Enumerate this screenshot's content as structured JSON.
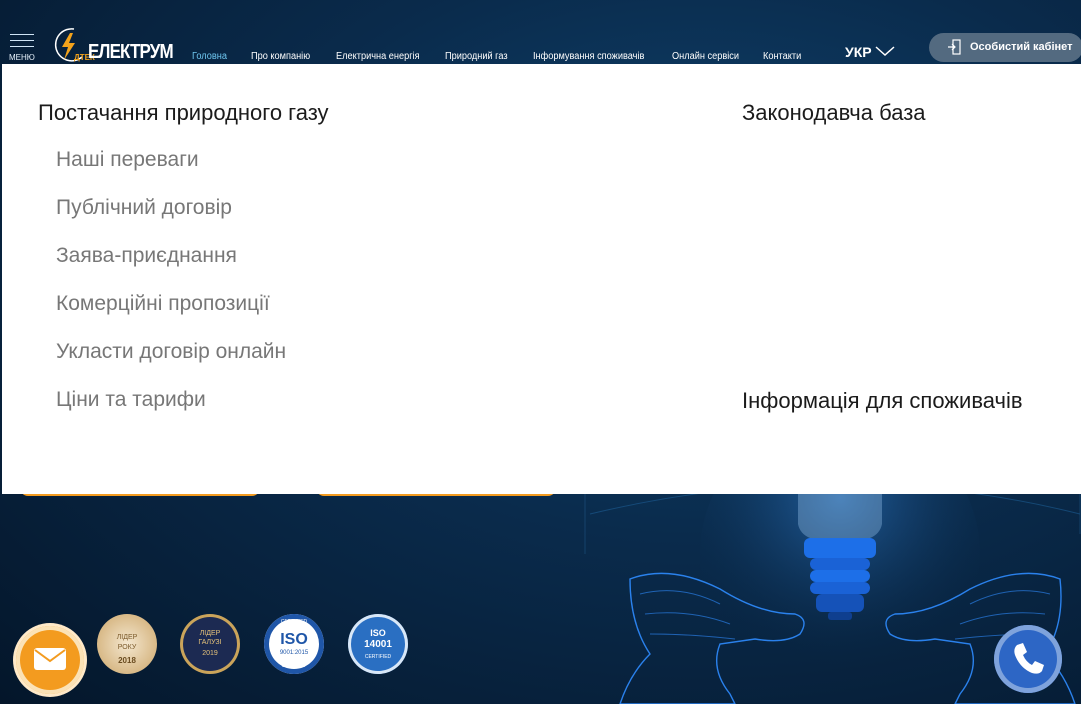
{
  "header": {
    "menu_label": "МЕНЮ",
    "logo_text": "ЕЛЕКТРУМ",
    "logo_sub": "ДТЕК",
    "nav": [
      {
        "label": "Головна",
        "active": true
      },
      {
        "label": "Про компанію",
        "active": false
      },
      {
        "label": "Електрична енергія",
        "active": false
      },
      {
        "label": "Природний газ",
        "active": false
      },
      {
        "label": "Інформування споживачів",
        "active": false
      },
      {
        "label": "Онлайн сервіси",
        "active": false
      },
      {
        "label": "Контакти",
        "active": false
      }
    ],
    "language": "УКР",
    "cabinet_label": "Особистий кабінет"
  },
  "dropdown": {
    "col1_heading": "Постачання природного газу",
    "col1_items": [
      "Наші переваги",
      "Публічний договір",
      "Заява-приєднання",
      "Комерційні пропозиції",
      "Укласти договір онлайн",
      "Ціни та тарифи"
    ],
    "col2_heading": "Законодавча база",
    "col2_heading_2": "Інформація для споживачів"
  },
  "badges": [
    {
      "name": "leader-year-badge",
      "line1": "ЛІДЕР",
      "line2": "РОКУ",
      "line3": "2018"
    },
    {
      "name": "leader-industry-badge",
      "line1": "ЛІДЕР",
      "line2": "ГАЛУЗІ",
      "line3": "2019"
    },
    {
      "name": "iso-9001-badge",
      "line1": "CERTIFIED",
      "line2": "ISO",
      "line3": "9001:2015",
      "line4": "COMPANY"
    },
    {
      "name": "iso-14001-badge",
      "line1": "ISO",
      "line2": "14001",
      "line3": "CERTIFIED"
    }
  ],
  "colors": {
    "accent_orange": "#f39b1f",
    "nav_active": "#6ec6ef",
    "phone_blue": "#2d66c5",
    "cabinet_bg": "#536a80"
  },
  "icons": {
    "menu": "hamburger-icon",
    "logo": "lightning-icon",
    "lang": "chevron-down-icon",
    "cabinet": "login-door-icon",
    "mail": "envelope-icon",
    "phone": "phone-icon"
  }
}
